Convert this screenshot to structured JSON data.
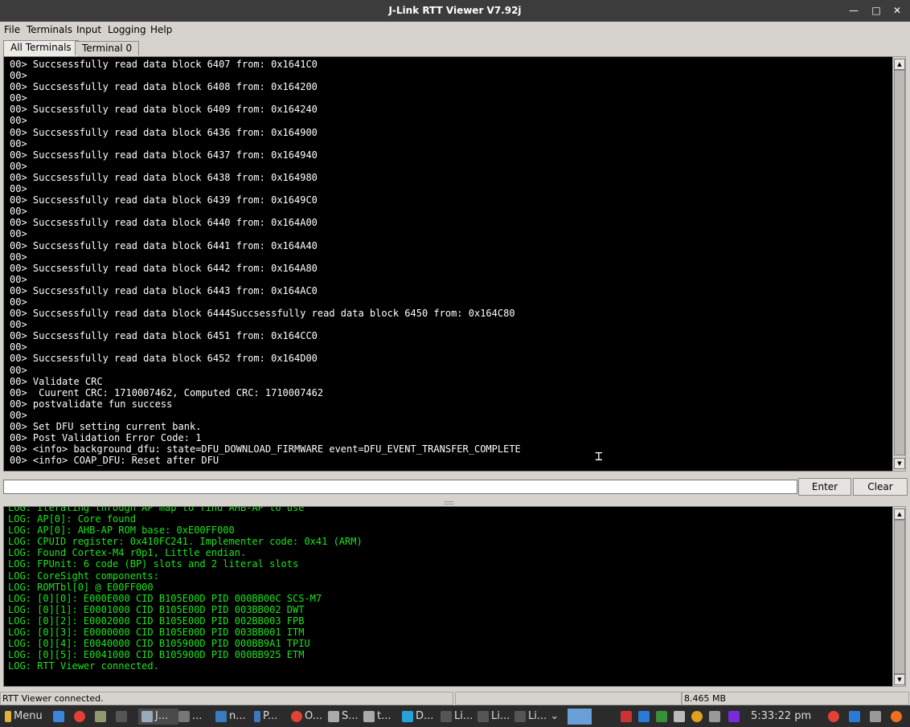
{
  "window": {
    "title": "J-Link RTT Viewer V7.92j"
  },
  "menu": [
    "File",
    "Terminals",
    "Input",
    "Logging",
    "Help"
  ],
  "tabs": [
    "All Terminals",
    "Terminal 0"
  ],
  "terminal_lines": [
    "00> Succsessfully read data block 6407 from: 0x1641C0",
    "00>",
    "00> Succsessfully read data block 6408 from: 0x164200",
    "00>",
    "00> Succsessfully read data block 6409 from: 0x164240",
    "00>",
    "00> Succsessfully read data block 6436 from: 0x164900",
    "00>",
    "00> Succsessfully read data block 6437 from: 0x164940",
    "00>",
    "00> Succsessfully read data block 6438 from: 0x164980",
    "00>",
    "00> Succsessfully read data block 6439 from: 0x1649C0",
    "00>",
    "00> Succsessfully read data block 6440 from: 0x164A00",
    "00>",
    "00> Succsessfully read data block 6441 from: 0x164A40",
    "00>",
    "00> Succsessfully read data block 6442 from: 0x164A80",
    "00>",
    "00> Succsessfully read data block 6443 from: 0x164AC0",
    "00>",
    "00> Succsessfully read data block 6444Succsessfully read data block 6450 from: 0x164C80",
    "00>",
    "00> Succsessfully read data block 6451 from: 0x164CC0",
    "00>",
    "00> Succsessfully read data block 6452 from: 0x164D00",
    "00>",
    "00> Validate CRC",
    "00>  Cuurent CRC: 1710007462, Computed CRC: 1710007462",
    "00> postvalidate fun success",
    "00>",
    "00> Set DFU setting current bank.",
    "00> Post Validation Error Code: 1",
    "00> <info> background_dfu: state=DFU_DOWNLOAD_FIRMWARE event=DFU_EVENT_TRANSFER_COMPLETE",
    "00> <info> COAP_DFU: Reset after DFU"
  ],
  "input": {
    "value": "",
    "enter_label": "Enter",
    "clear_label": "Clear"
  },
  "log_lines": [
    "LOG: Iterating through AP map to find AHB-AP to use",
    "LOG: AP[0]: Core found",
    "LOG: AP[0]: AHB-AP ROM base: 0xE00FF000",
    "LOG: CPUID register: 0x410FC241. Implementer code: 0x41 (ARM)",
    "LOG: Found Cortex-M4 r0p1, Little endian.",
    "LOG: FPUnit: 6 code (BP) slots and 2 literal slots",
    "LOG: CoreSight components:",
    "LOG: ROMTbl[0] @ E00FF000",
    "LOG: [0][0]: E000E000 CID B105E00D PID 000BB00C SCS-M7",
    "LOG: [0][1]: E0001000 CID B105E00D PID 003BB002 DWT",
    "LOG: [0][2]: E0002000 CID B105E00D PID 002BB003 FPB",
    "LOG: [0][3]: E0000000 CID B105E00D PID 003BB001 ITM",
    "LOG: [0][4]: E0040000 CID B105900D PID 000BB9A1 TPIU",
    "LOG: [0][5]: E0041000 CID B105900D PID 000BB925 ETM",
    "LOG: RTT Viewer connected."
  ],
  "status": {
    "message": "RTT Viewer connected.",
    "memory": "8.465 MB"
  },
  "taskbar": {
    "menu_label": "Menu",
    "items": [
      "J...",
      "...",
      "n...",
      "P...",
      "O...",
      "S...",
      "t...",
      "D...",
      "Li...",
      "Li...",
      "Li..."
    ],
    "clock": "5:33:22 pm"
  },
  "colors": {
    "terminal_bg": "#000000",
    "terminal_fg": "#ffffff",
    "log_fg": "#19e619",
    "titlebar": "#3c3c3c"
  }
}
